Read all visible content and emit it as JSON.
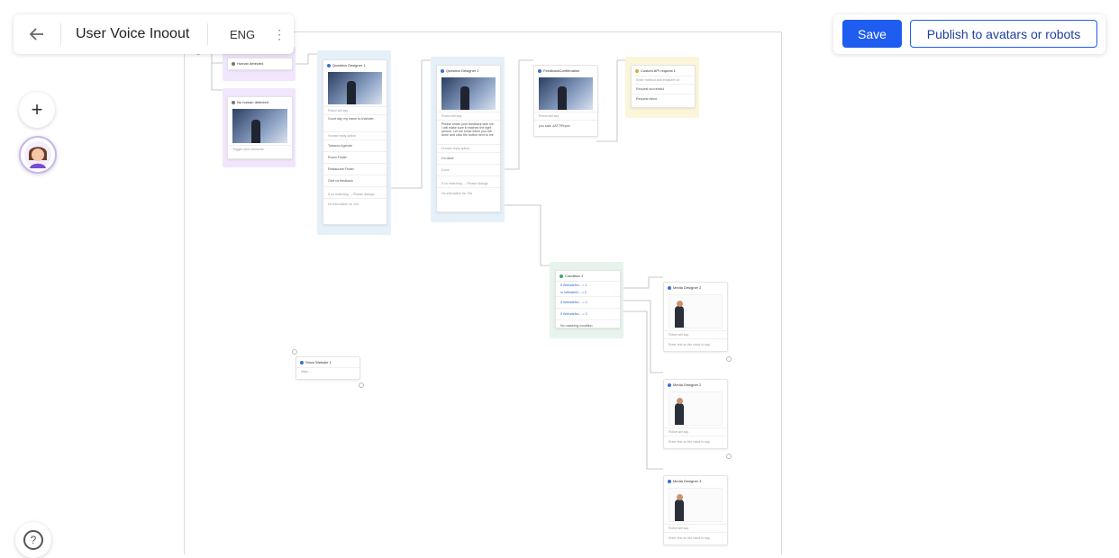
{
  "header": {
    "title": "User Voice Inoout",
    "language": "ENG",
    "save_label": "Save",
    "publish_label": "Publish to avatars or robots"
  },
  "sidebar": {
    "add_label": "+",
    "help_label": "?"
  },
  "colors": {
    "primary": "#1f5cf0",
    "purple_group": "#f1e6fb",
    "blue_group": "#e6f0f8",
    "green_group": "#e6f4ec",
    "yellow_group": "#fbf5d9"
  },
  "nodes": {
    "human_detected": {
      "title": "Human detected"
    },
    "no_human": {
      "title": "No human detected",
      "line1": "Trigger next elements"
    },
    "qd1": {
      "title": "Question Designer 1",
      "robot_say": "Robot will say",
      "robot_text": "Good day, my name is charlotte.",
      "reply_option": "Human reply option",
      "opt1": "Tobacco Agenda",
      "opt2": "Room Finder",
      "opt3": "Restaurant Finder",
      "opt4": "Give us feedback",
      "no_match": "If no matching → Please dialogs",
      "no_interaction": "No interaction for 10s"
    },
    "qd2": {
      "title": "Question Designer 2",
      "robot_say": "Robot will say",
      "robot_text": "Please share your feedback with me. I will make sure it reaches the right person. Let me know when you are done and click the button next to me",
      "reply_option": "Human reply option",
      "opt1": "I'm done",
      "opt2": "Done",
      "no_match": "If no matching → Please dialogs",
      "no_interaction": "No interaction for 10s"
    },
    "feedback": {
      "title": "FeedbackConfirmation",
      "robot_say": "Robot will say",
      "robot_text": "you said: #ATTRInput"
    },
    "api": {
      "title": "Custom API request 1",
      "line1": "Enter method and endpoint url",
      "ok": "Request successful",
      "fail": "Request failed"
    },
    "condition": {
      "title": "Condition 1",
      "c1a": "If WebsiteNo... = 1",
      "c1b": "or WebsiteN... = 2",
      "c2": "If WebsiteNo... = 2",
      "c3": "If WebsiteNo... = 3",
      "none": "No matching condition"
    },
    "media2": {
      "title": "Media Designer 2",
      "robot_say": "Robot will say",
      "text": "Enter text so the robot to say"
    },
    "media3": {
      "title": "Media Designer 2",
      "robot_say": "Robot will say",
      "text": "Enter text so the robot to say"
    },
    "media4": {
      "title": "Media Designer 3",
      "robot_say": "Robot will say",
      "text": "Enter text so the robot to say"
    },
    "show_website": {
      "title": "Show Website 1",
      "line1": "https: ..."
    }
  }
}
